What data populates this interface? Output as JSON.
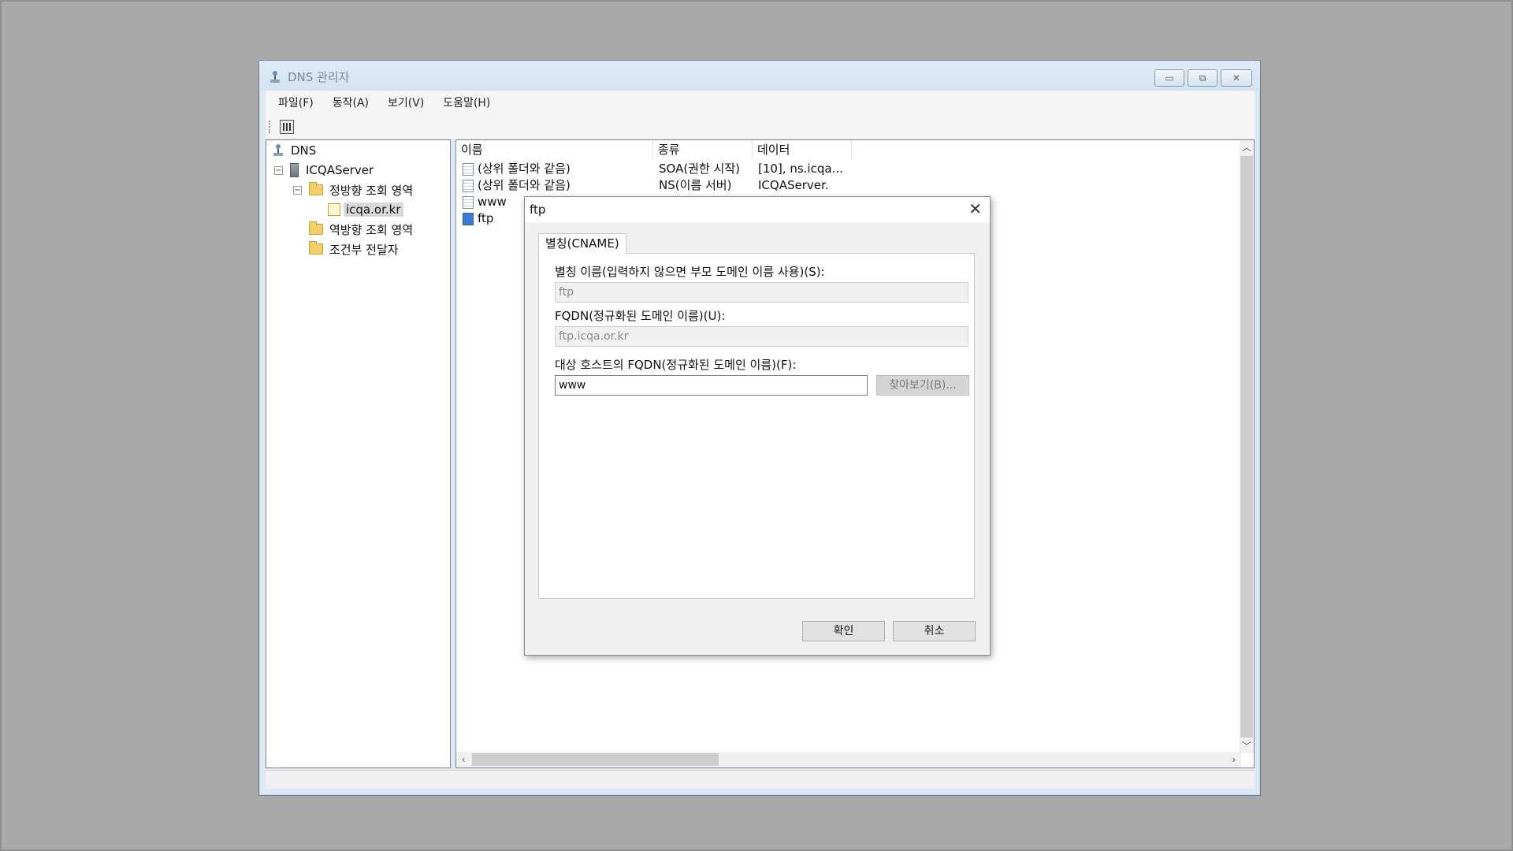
{
  "main_window": {
    "title": "DNS 관리자",
    "menu": [
      "파일(F)",
      "동작(A)",
      "보기(V)",
      "도움말(H)"
    ]
  },
  "tree": {
    "root": "DNS",
    "server": "ICQAServer",
    "forward_zones": "정방향 조회 영역",
    "zone": "icqa.or.kr",
    "reverse_zones": "역방향 조회 영역",
    "conditional_forwarders": "조건부 전달자"
  },
  "list": {
    "columns": [
      "이름",
      "종류",
      "데이터"
    ],
    "rows": [
      {
        "name": "(상위 폴더와 같음)",
        "type": "SOA(권한 시작)",
        "data": "[10], ns.icqa..."
      },
      {
        "name": "(상위 폴더와 같음)",
        "type": "NS(이름 서버)",
        "data": "ICQAServer."
      },
      {
        "name": "www",
        "type": "",
        "data": ""
      },
      {
        "name": "ftp",
        "type": "",
        "data": ""
      }
    ]
  },
  "dialog": {
    "title": "ftp",
    "tab_label": "별칭(CNAME)",
    "alias_label": "별칭 이름(입력하지 않으면 부모 도메인 이름 사용)(S):",
    "alias_value": "ftp",
    "fqdn_label": "FQDN(정규화된 도메인 이름)(U):",
    "fqdn_value": "ftp.icqa.or.kr",
    "target_label": "대상 호스트의 FQDN(정규화된 도메인 이름)(F):",
    "target_value": "www",
    "browse_label": "찾아보기(B)...",
    "ok_label": "확인",
    "cancel_label": "취소"
  }
}
